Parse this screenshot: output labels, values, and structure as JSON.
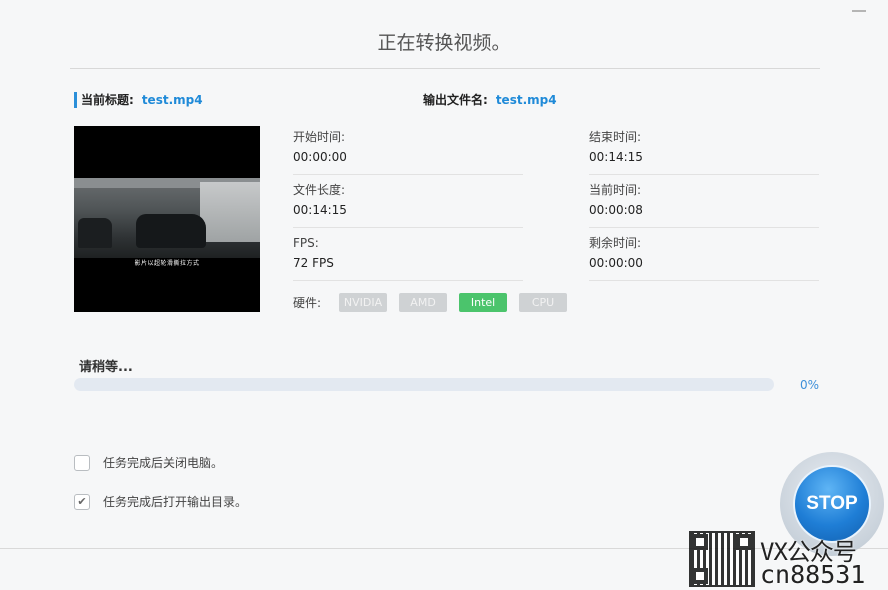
{
  "window": {
    "title": "正在转换视频。"
  },
  "file": {
    "current_title_label": "当前标题:",
    "current_title_value": "test.mp4",
    "output_name_label": "输出文件名:",
    "output_name_value": "test.mp4"
  },
  "preview": {
    "subtitle": "影片以超轮滑撕拉方式"
  },
  "info": {
    "start_time_label": "开始时间:",
    "start_time_value": "00:00:00",
    "end_time_label": "结束时间:",
    "end_time_value": "00:14:15",
    "file_length_label": "文件长度:",
    "file_length_value": "00:14:15",
    "current_time_label": "当前时间:",
    "current_time_value": "00:00:08",
    "fps_label": "FPS:",
    "fps_value": "72 FPS",
    "remaining_time_label": "剩余时间:",
    "remaining_time_value": "00:00:00"
  },
  "hardware": {
    "label": "硬件:",
    "options": [
      "NVIDIA",
      "AMD",
      "Intel",
      "CPU"
    ],
    "active": "Intel",
    "active_color": "#4bc46c"
  },
  "progress": {
    "status": "请稍等...",
    "percent_text": "0%",
    "value": 0,
    "color": "#3d8fd9"
  },
  "options": {
    "shutdown_label": "任务完成后关闭电脑。",
    "shutdown_checked": false,
    "open_output_label": "任务完成后打开输出目录。",
    "open_output_checked": true
  },
  "stop_button": {
    "label": "STOP",
    "color": "#1f7ed6"
  },
  "watermark": {
    "line1": "VX公众号",
    "line2": "cn88531"
  }
}
